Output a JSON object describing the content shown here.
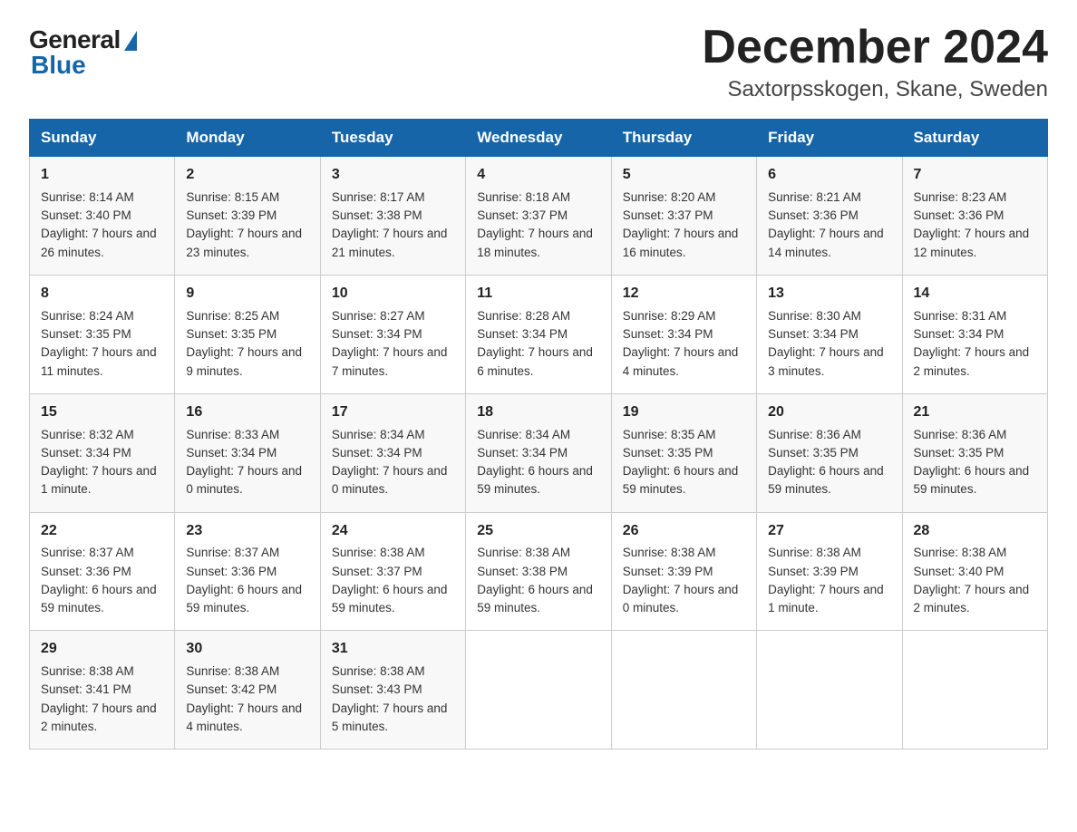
{
  "logo": {
    "general": "General",
    "blue": "Blue"
  },
  "title": "December 2024",
  "subtitle": "Saxtorpsskogen, Skane, Sweden",
  "days_of_week": [
    "Sunday",
    "Monday",
    "Tuesday",
    "Wednesday",
    "Thursday",
    "Friday",
    "Saturday"
  ],
  "weeks": [
    [
      {
        "date": "1",
        "sunrise": "8:14 AM",
        "sunset": "3:40 PM",
        "daylight": "7 hours and 26 minutes."
      },
      {
        "date": "2",
        "sunrise": "8:15 AM",
        "sunset": "3:39 PM",
        "daylight": "7 hours and 23 minutes."
      },
      {
        "date": "3",
        "sunrise": "8:17 AM",
        "sunset": "3:38 PM",
        "daylight": "7 hours and 21 minutes."
      },
      {
        "date": "4",
        "sunrise": "8:18 AM",
        "sunset": "3:37 PM",
        "daylight": "7 hours and 18 minutes."
      },
      {
        "date": "5",
        "sunrise": "8:20 AM",
        "sunset": "3:37 PM",
        "daylight": "7 hours and 16 minutes."
      },
      {
        "date": "6",
        "sunrise": "8:21 AM",
        "sunset": "3:36 PM",
        "daylight": "7 hours and 14 minutes."
      },
      {
        "date": "7",
        "sunrise": "8:23 AM",
        "sunset": "3:36 PM",
        "daylight": "7 hours and 12 minutes."
      }
    ],
    [
      {
        "date": "8",
        "sunrise": "8:24 AM",
        "sunset": "3:35 PM",
        "daylight": "7 hours and 11 minutes."
      },
      {
        "date": "9",
        "sunrise": "8:25 AM",
        "sunset": "3:35 PM",
        "daylight": "7 hours and 9 minutes."
      },
      {
        "date": "10",
        "sunrise": "8:27 AM",
        "sunset": "3:34 PM",
        "daylight": "7 hours and 7 minutes."
      },
      {
        "date": "11",
        "sunrise": "8:28 AM",
        "sunset": "3:34 PM",
        "daylight": "7 hours and 6 minutes."
      },
      {
        "date": "12",
        "sunrise": "8:29 AM",
        "sunset": "3:34 PM",
        "daylight": "7 hours and 4 minutes."
      },
      {
        "date": "13",
        "sunrise": "8:30 AM",
        "sunset": "3:34 PM",
        "daylight": "7 hours and 3 minutes."
      },
      {
        "date": "14",
        "sunrise": "8:31 AM",
        "sunset": "3:34 PM",
        "daylight": "7 hours and 2 minutes."
      }
    ],
    [
      {
        "date": "15",
        "sunrise": "8:32 AM",
        "sunset": "3:34 PM",
        "daylight": "7 hours and 1 minute."
      },
      {
        "date": "16",
        "sunrise": "8:33 AM",
        "sunset": "3:34 PM",
        "daylight": "7 hours and 0 minutes."
      },
      {
        "date": "17",
        "sunrise": "8:34 AM",
        "sunset": "3:34 PM",
        "daylight": "7 hours and 0 minutes."
      },
      {
        "date": "18",
        "sunrise": "8:34 AM",
        "sunset": "3:34 PM",
        "daylight": "6 hours and 59 minutes."
      },
      {
        "date": "19",
        "sunrise": "8:35 AM",
        "sunset": "3:35 PM",
        "daylight": "6 hours and 59 minutes."
      },
      {
        "date": "20",
        "sunrise": "8:36 AM",
        "sunset": "3:35 PM",
        "daylight": "6 hours and 59 minutes."
      },
      {
        "date": "21",
        "sunrise": "8:36 AM",
        "sunset": "3:35 PM",
        "daylight": "6 hours and 59 minutes."
      }
    ],
    [
      {
        "date": "22",
        "sunrise": "8:37 AM",
        "sunset": "3:36 PM",
        "daylight": "6 hours and 59 minutes."
      },
      {
        "date": "23",
        "sunrise": "8:37 AM",
        "sunset": "3:36 PM",
        "daylight": "6 hours and 59 minutes."
      },
      {
        "date": "24",
        "sunrise": "8:38 AM",
        "sunset": "3:37 PM",
        "daylight": "6 hours and 59 minutes."
      },
      {
        "date": "25",
        "sunrise": "8:38 AM",
        "sunset": "3:38 PM",
        "daylight": "6 hours and 59 minutes."
      },
      {
        "date": "26",
        "sunrise": "8:38 AM",
        "sunset": "3:39 PM",
        "daylight": "7 hours and 0 minutes."
      },
      {
        "date": "27",
        "sunrise": "8:38 AM",
        "sunset": "3:39 PM",
        "daylight": "7 hours and 1 minute."
      },
      {
        "date": "28",
        "sunrise": "8:38 AM",
        "sunset": "3:40 PM",
        "daylight": "7 hours and 2 minutes."
      }
    ],
    [
      {
        "date": "29",
        "sunrise": "8:38 AM",
        "sunset": "3:41 PM",
        "daylight": "7 hours and 2 minutes."
      },
      {
        "date": "30",
        "sunrise": "8:38 AM",
        "sunset": "3:42 PM",
        "daylight": "7 hours and 4 minutes."
      },
      {
        "date": "31",
        "sunrise": "8:38 AM",
        "sunset": "3:43 PM",
        "daylight": "7 hours and 5 minutes."
      },
      null,
      null,
      null,
      null
    ]
  ],
  "labels": {
    "sunrise": "Sunrise:",
    "sunset": "Sunset:",
    "daylight": "Daylight:"
  }
}
